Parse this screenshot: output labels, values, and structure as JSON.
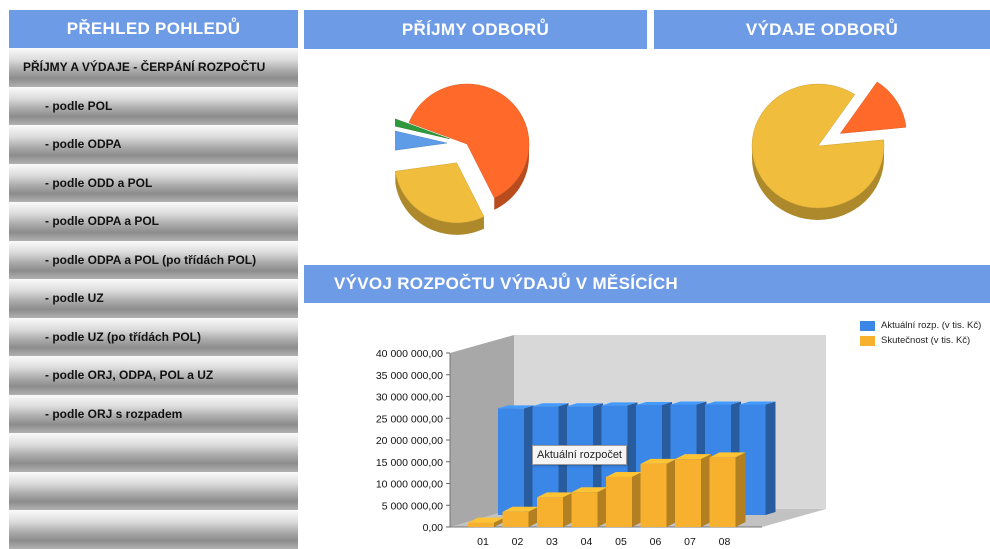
{
  "sidebar": {
    "title": "PŘEHLED POHLEDŮ",
    "section": "PŘÍJMY A VÝDAJE - ČERPÁNÍ ROZPOČTU",
    "items": [
      "- podle POL",
      "- podle ODPA",
      "- podle ODD a POL",
      "- podle ODPA a POL",
      "- podle ODPA a POL (po třídách POL)",
      "- podle UZ",
      "- podle UZ (po třídách POL)",
      "- podle ORJ, ODPA, POL a UZ",
      "- podle ORJ s rozpadem"
    ]
  },
  "panels": {
    "prijmy_title": "PŘÍJMY ODBORŮ",
    "vydaje_title": "VÝDAJE ODBORŮ",
    "vyvoj_title": "VÝVOJ ROZPOČTU VÝDAJŮ V MĚSÍCÍCH"
  },
  "tooltip": "Aktuální rozpočet",
  "colors": {
    "header_blue": "#6e9be6",
    "pie_orange": "#ff6a2b",
    "pie_yellow": "#f0be3c",
    "pie_blue": "#5f9ce8",
    "pie_green": "#2f9a3c",
    "bar_blue": "#3b87e8",
    "bar_yellow": "#f7b12e"
  },
  "chart_data": [
    {
      "type": "pie",
      "slices": [
        {
          "value": 62,
          "color": "#ff6a2b"
        },
        {
          "value": 30,
          "color": "#f0be3c"
        },
        {
          "value": 6,
          "color": "#5f9ce8"
        },
        {
          "value": 2,
          "color": "#2f9a3c"
        }
      ]
    },
    {
      "type": "pie",
      "slices": [
        {
          "value": 86,
          "color": "#f0be3c"
        },
        {
          "value": 14,
          "color": "#ff6a2b"
        }
      ]
    },
    {
      "type": "bar",
      "categories": [
        "01",
        "02",
        "03",
        "04",
        "05",
        "06",
        "07",
        "08"
      ],
      "series": [
        {
          "name": "Aktuální rozp. (v tis. Kč)",
          "color": "#3b87e8",
          "values": [
            24500000,
            25000000,
            25000000,
            25200000,
            25300000,
            25400000,
            25400000,
            25400000
          ]
        },
        {
          "name": "Skutečnost (v tis. Kč)",
          "color": "#f7b12e",
          "values": [
            1000000,
            3500000,
            6800000,
            8000000,
            11500000,
            14500000,
            15600000,
            16000000
          ]
        }
      ],
      "ylim": [
        0,
        40000000
      ],
      "yticks": [
        "0,00",
        "5 000 000,00",
        "10 000 000,00",
        "15 000 000,00",
        "20 000 000,00",
        "25 000 000,00",
        "30 000 000,00",
        "35 000 000,00",
        "40 000 000,00"
      ],
      "legend": "top-right",
      "grid": false
    }
  ]
}
